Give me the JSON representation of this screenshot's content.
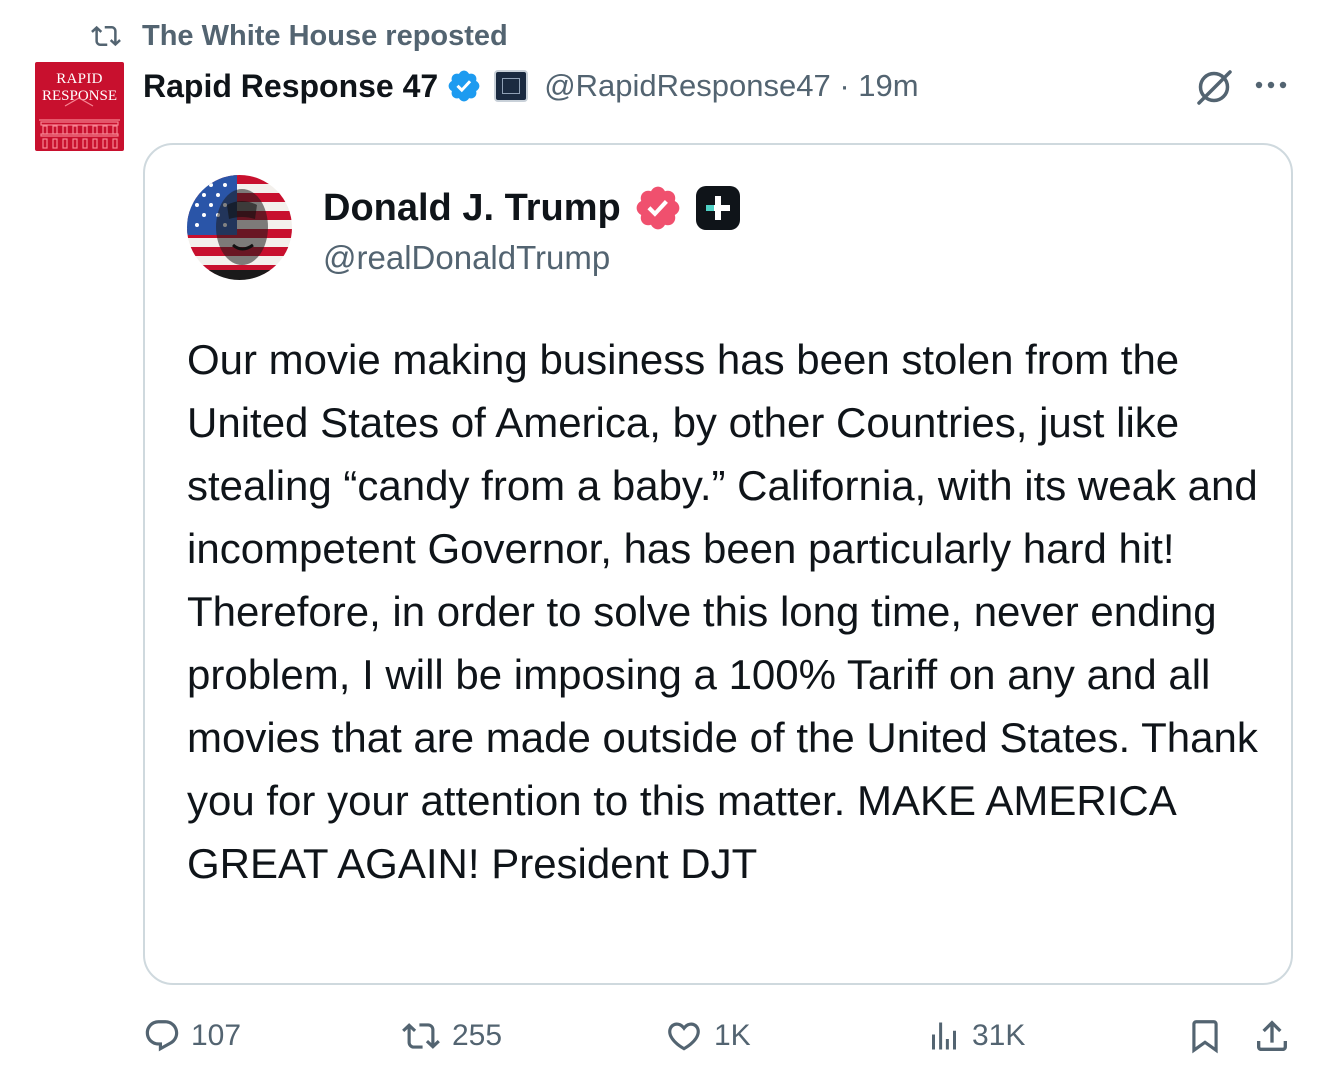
{
  "repost_banner": {
    "text": "The White House reposted"
  },
  "post": {
    "avatar_text_line1": "RAPID",
    "avatar_text_line2": "RESPONSE",
    "display_name": "Rapid Response 47",
    "handle_time": "@RapidResponse47 · 19m"
  },
  "quoted_post": {
    "display_name": "Donald J. Trump",
    "handle": "@realDonaldTrump",
    "text": "Our movie making business has been stolen from the United States of America, by other Countries, just like stealing “candy from a baby.” California, with its weak and incompetent Governor, has been particularly hard hit! Therefore, in order to solve this long time, never ending problem, I will be imposing a 100% Tariff on any and all movies that are made outside of the United States. Thank you for your attention to this matter. MAKE AMERICA GREAT AGAIN! President DJT"
  },
  "actions": {
    "replies": "107",
    "reposts": "255",
    "likes": "1K",
    "views": "31K"
  },
  "icons": {
    "repost": "repost-icon",
    "verified": "verified-badge-icon",
    "affiliation": "white-house-affiliation-icon",
    "grok": "grok-icon",
    "more": "more-icon",
    "reply": "reply-icon",
    "like": "like-icon",
    "views": "views-icon",
    "bookmark": "bookmark-icon",
    "share": "share-icon",
    "pink_verified": "pink-verified-badge-icon",
    "plus": "plus-badge-icon"
  },
  "colors": {
    "text_primary": "#0f1419",
    "text_secondary": "#536471",
    "verified_blue": "#1d9bf0",
    "verified_gold_pink": "#f0506e",
    "card_border": "#cfd9de",
    "avatar_red": "#c8102e"
  }
}
